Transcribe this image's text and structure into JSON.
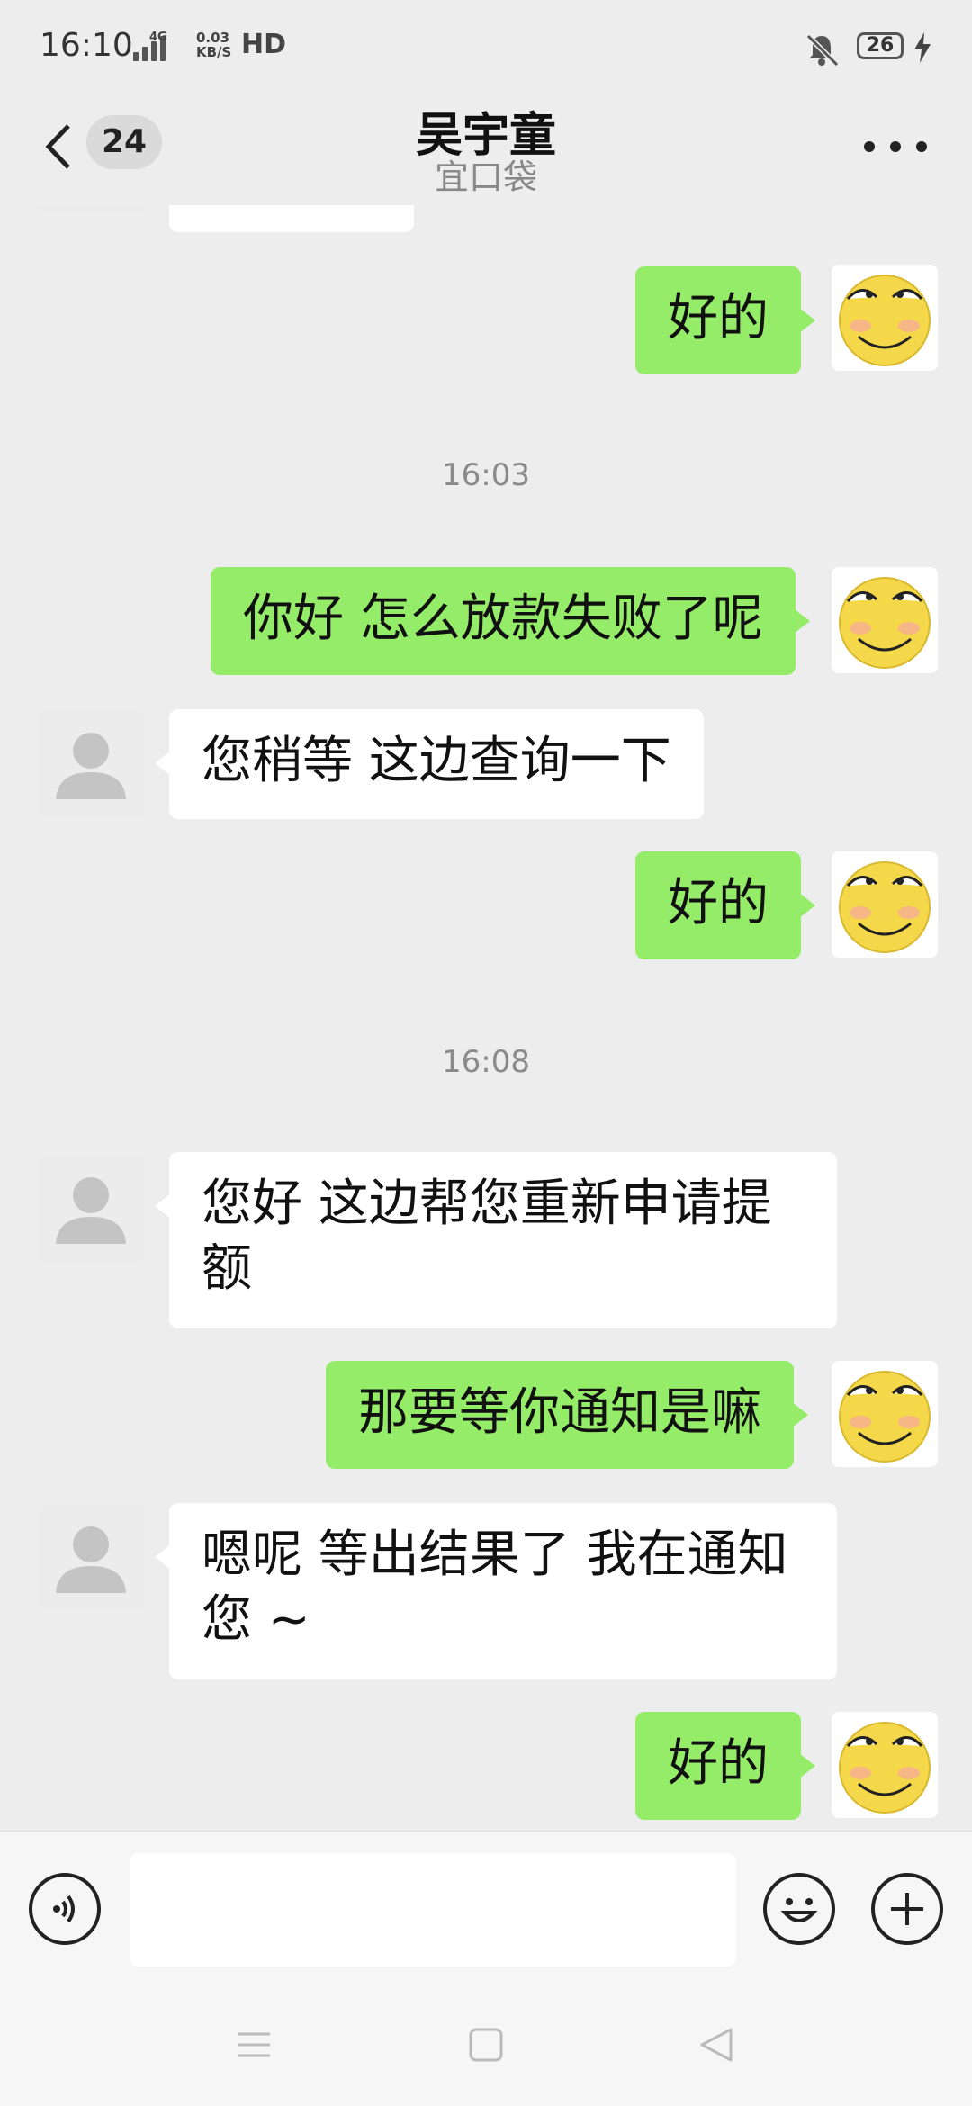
{
  "status_bar": {
    "time": "16:10",
    "network_type": "4G",
    "speed_value": "0.03",
    "speed_unit": "KB/S",
    "hd_label": "HD",
    "battery": "26"
  },
  "header": {
    "unread_count": "24",
    "title": "吴宇童",
    "subtitle": "宜口袋"
  },
  "messages": [
    {
      "type": "me",
      "text": "好的"
    },
    {
      "type": "time",
      "text": "16:03"
    },
    {
      "type": "me",
      "text": "你好 怎么放款失败了呢"
    },
    {
      "type": "them",
      "text": "您稍等  这边查询一下"
    },
    {
      "type": "me",
      "text": "好的"
    },
    {
      "type": "time",
      "text": "16:08"
    },
    {
      "type": "them",
      "line1": "您好  这边帮您重新申请提",
      "line2": "额"
    },
    {
      "type": "me",
      "text": "那要等你通知是嘛"
    },
    {
      "type": "them",
      "line1": "嗯呢  等出结果了 我在通知",
      "line2": "您 ~"
    },
    {
      "type": "me",
      "text": "好的"
    }
  ],
  "colors": {
    "background": "#ededed",
    "my_bubble": "#95ec69",
    "their_bubble": "#ffffff",
    "timestamp": "#8a8a8a"
  },
  "icons": {
    "voice": "voice-icon",
    "emoji": "emoji-icon",
    "add": "plus-icon",
    "back": "back-arrow-icon",
    "more": "more-icon"
  }
}
